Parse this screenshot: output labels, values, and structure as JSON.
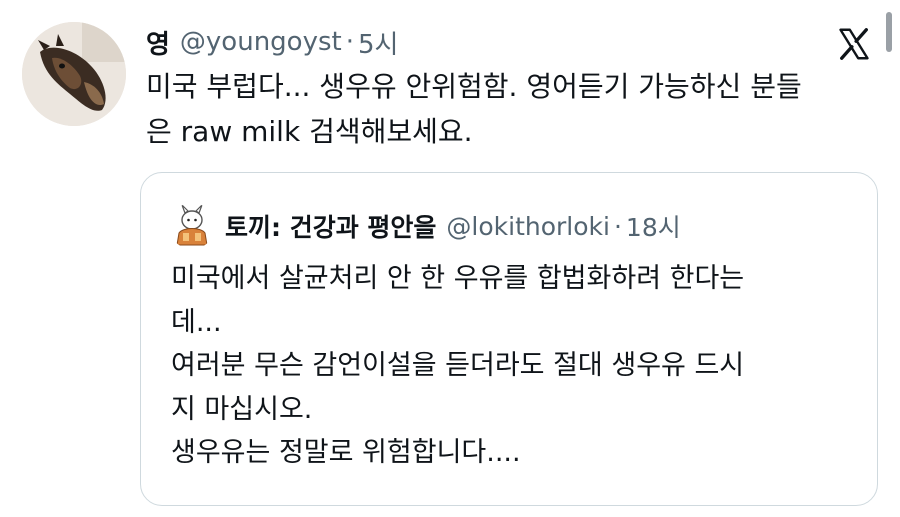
{
  "tweet": {
    "author_name": "영",
    "handle": "@youngoyst",
    "separator": "·",
    "time": "5시",
    "text_lines": [
      "미국 부럽다... 생우유 안위험함. 영어듣기 가능하신 분들",
      "은 raw milk 검색해보세요."
    ],
    "avatar_icon": "dog-photo-avatar"
  },
  "quoted": {
    "author_name": "토끼: 건강과 평안을",
    "handle": "@lokithorloki",
    "separator": "·",
    "time": "18시",
    "text_lines": [
      "미국에서 살균처리 안 한 우유를 합법화하려 한다는",
      "데...",
      "여러분 무슨 감언이설을 듣더라도 절대 생우유 드시",
      "지 마십시오.",
      "생우유는 정말로 위험합니다...."
    ],
    "avatar_icon": "rabbit-drawing-avatar"
  },
  "chrome": {
    "logo_icon": "x-logo-icon",
    "border_color": "#cfd9de",
    "secondary_text_color": "#536471",
    "primary_text_color": "#0f1419"
  }
}
